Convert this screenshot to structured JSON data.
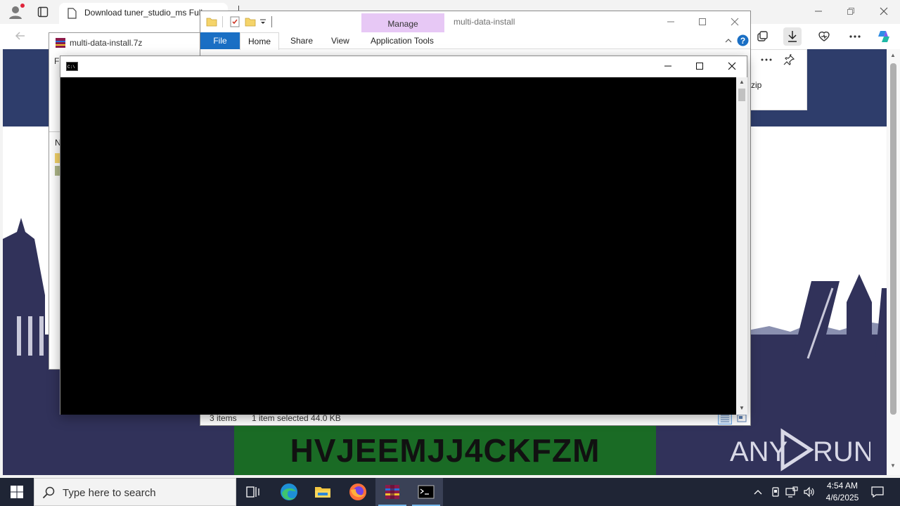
{
  "browser": {
    "tab_title": "Download tuner_studio_ms Full",
    "tab_close_glyph": "×"
  },
  "download_panel": {
    "item_text": "zip"
  },
  "captcha": {
    "text": "HVJEEMJJ4CKFZM"
  },
  "watermark": {
    "text_left": "ANY",
    "text_right": "RUN"
  },
  "winrar": {
    "title": "multi-data-install.7z",
    "menu_partial": "Fi",
    "column_partial": "N"
  },
  "explorer": {
    "title": "multi-data-install",
    "contextual_group": "Manage",
    "ribbon_tabs": {
      "file": "File",
      "home": "Home",
      "share": "Share",
      "view": "View",
      "app_tools": "Application Tools"
    },
    "status": {
      "item_count": "3 items",
      "selection": "1 item selected  44.0 KB"
    }
  },
  "console": {
    "icon_text": "C:\\"
  },
  "taskbar": {
    "search_placeholder": "Type here to search",
    "clock_time": "4:54 AM",
    "clock_date": "4/6/2025"
  },
  "colors": {
    "console_bg": "#000000",
    "captcha_bg": "#1a6b25",
    "manage_tab": "#e7c8f5",
    "file_tab": "#1a6fc4",
    "taskbar": "#1f2535",
    "page_bg": "#31325a"
  }
}
